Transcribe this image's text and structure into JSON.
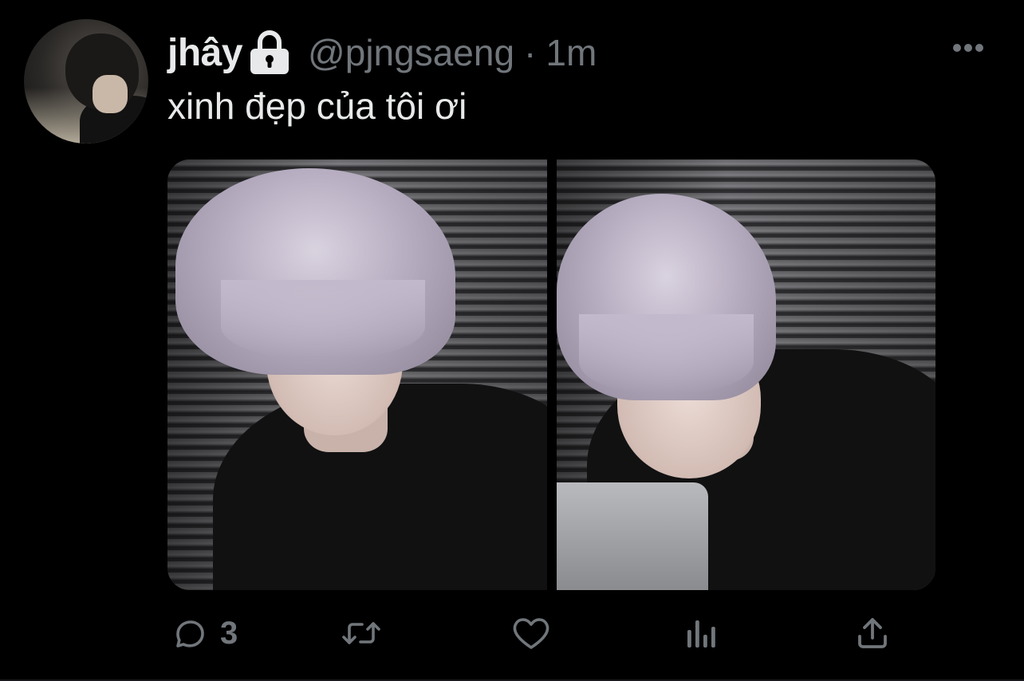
{
  "author": {
    "display_name": "jhây",
    "handle": "@pjngsaeng",
    "separator": "·",
    "timestamp": "1m",
    "protected_icon": "lock-icon"
  },
  "tweet": {
    "text": "xinh đẹp của tôi ơi",
    "media_count": 2
  },
  "actions": {
    "reply_icon": "reply-icon",
    "reply_count": "3",
    "retweet_icon": "retweet-icon",
    "like_icon": "heart-icon",
    "analytics_icon": "analytics-icon",
    "share_icon": "share-icon"
  },
  "more_icon": "more-icon",
  "colors": {
    "background": "#000000",
    "primary_text": "#e7e9ea",
    "secondary_text": "#71767b"
  }
}
